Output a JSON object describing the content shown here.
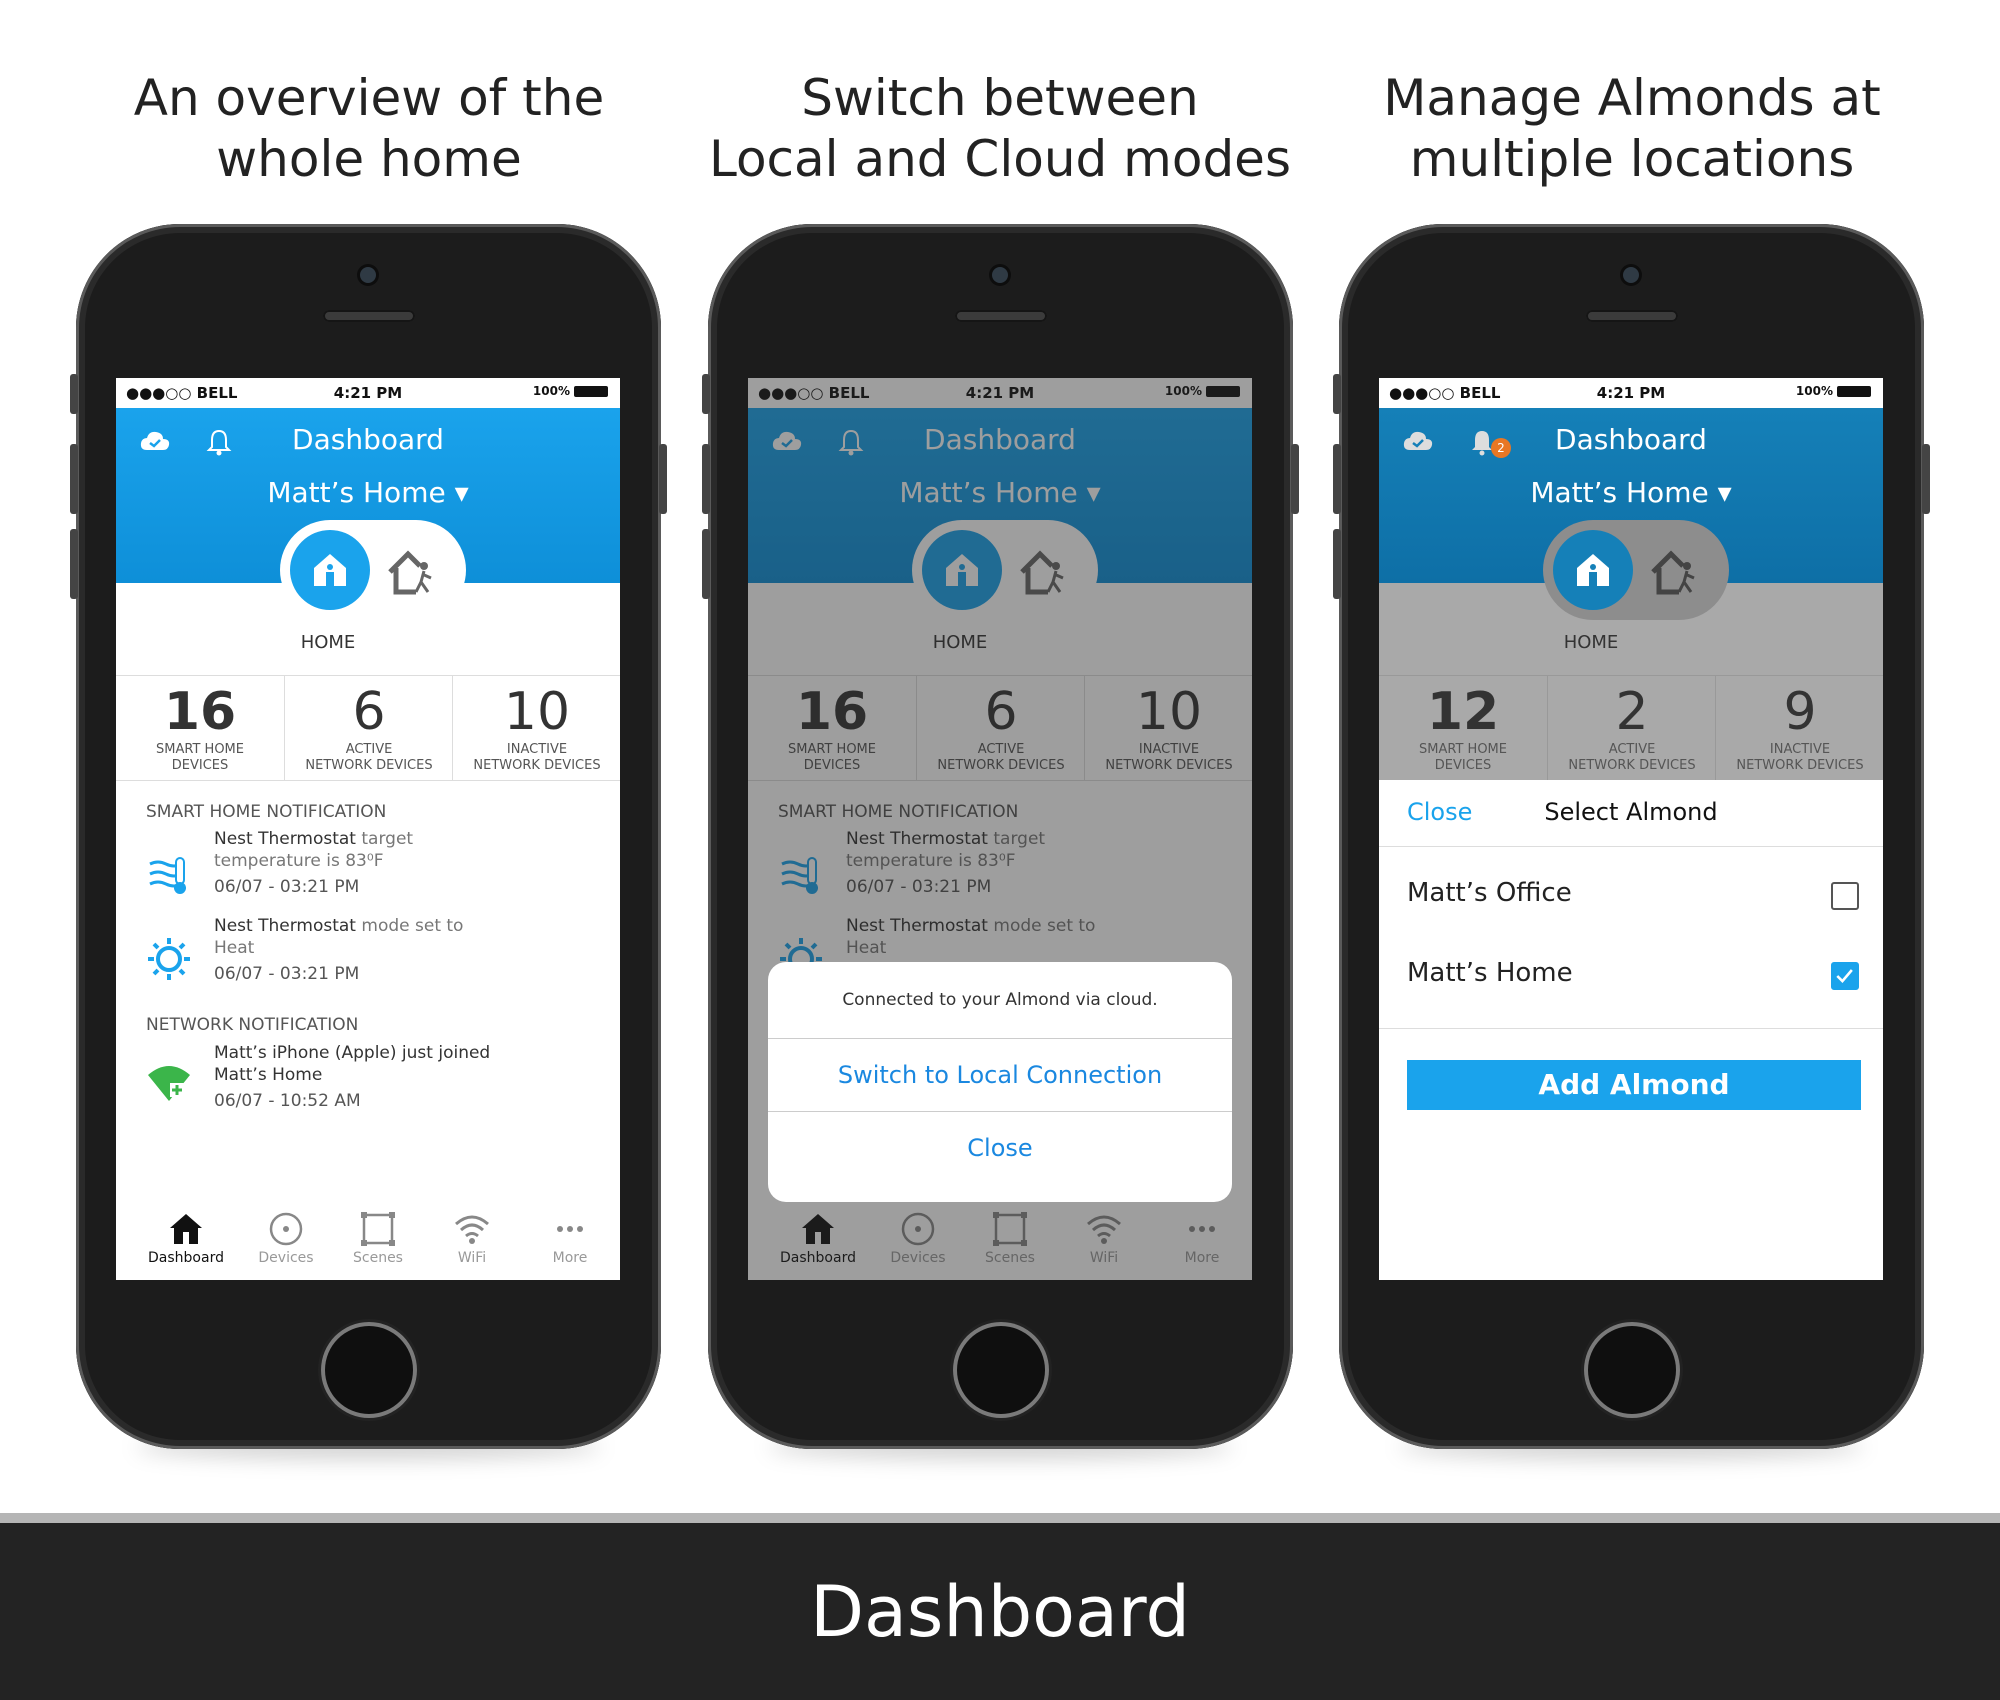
{
  "captions": [
    {
      "line1": "An overview of the",
      "line2": "whole home"
    },
    {
      "line1": "Switch between",
      "line2": "Local and Cloud modes"
    },
    {
      "line1": "Manage Almonds at",
      "line2": "multiple locations"
    }
  ],
  "status": {
    "carrier": "●●●○○ BELL",
    "time": "4:21 PM",
    "battery": "100%"
  },
  "header": {
    "title": "Dashboard",
    "home_name": "Matt’s Home ▾"
  },
  "mode_label": "HOME",
  "stats_a": [
    {
      "num": "16",
      "l1": "SMART HOME",
      "l2": "DEVICES"
    },
    {
      "num": "6",
      "l1": "ACTIVE",
      "l2": "NETWORK DEVICES"
    },
    {
      "num": "10",
      "l1": "INACTIVE",
      "l2": "NETWORK DEVICES"
    }
  ],
  "stats_c": [
    {
      "num": "12",
      "l1": "SMART HOME",
      "l2": "DEVICES"
    },
    {
      "num": "2",
      "l1": "ACTIVE",
      "l2": "NETWORK DEVICES"
    },
    {
      "num": "9",
      "l1": "INACTIVE",
      "l2": "NETWORK DEVICES"
    }
  ],
  "notifications": {
    "smart_title": "SMART HOME NOTIFICATION",
    "n1": {
      "bold": "Nest Thermostat",
      "rest1": " target",
      "rest2": "temperature is 83⁰F",
      "time": "06/07 - 03:21 PM"
    },
    "n2": {
      "bold": "Nest Thermostat",
      "rest1": " mode set to",
      "rest2": "Heat",
      "time": "06/07 - 03:21 PM"
    },
    "network_title": "NETWORK NOTIFICATION",
    "n3": {
      "line1": "Matt’s iPhone (Apple) just joined",
      "line2": "Matt’s Home",
      "time": "06/07 - 10:52 AM"
    }
  },
  "tabs": [
    "Dashboard",
    "Devices",
    "Scenes",
    "WiFi",
    "More"
  ],
  "sheet": {
    "message": "Connected to your Almond via cloud.",
    "switch": "Switch to Local Connection",
    "close": "Close"
  },
  "badge_count": "2",
  "select_panel": {
    "close": "Close",
    "title": "Select Almond",
    "locations": [
      {
        "name": "Matt’s Office",
        "checked": false
      },
      {
        "name": "Matt’s Home",
        "checked": true
      }
    ],
    "add": "Add Almond"
  },
  "footer": "Dashboard",
  "colors": {
    "accent": "#1aa3ec",
    "footer_bg": "#232323",
    "badge": "#e87724"
  }
}
